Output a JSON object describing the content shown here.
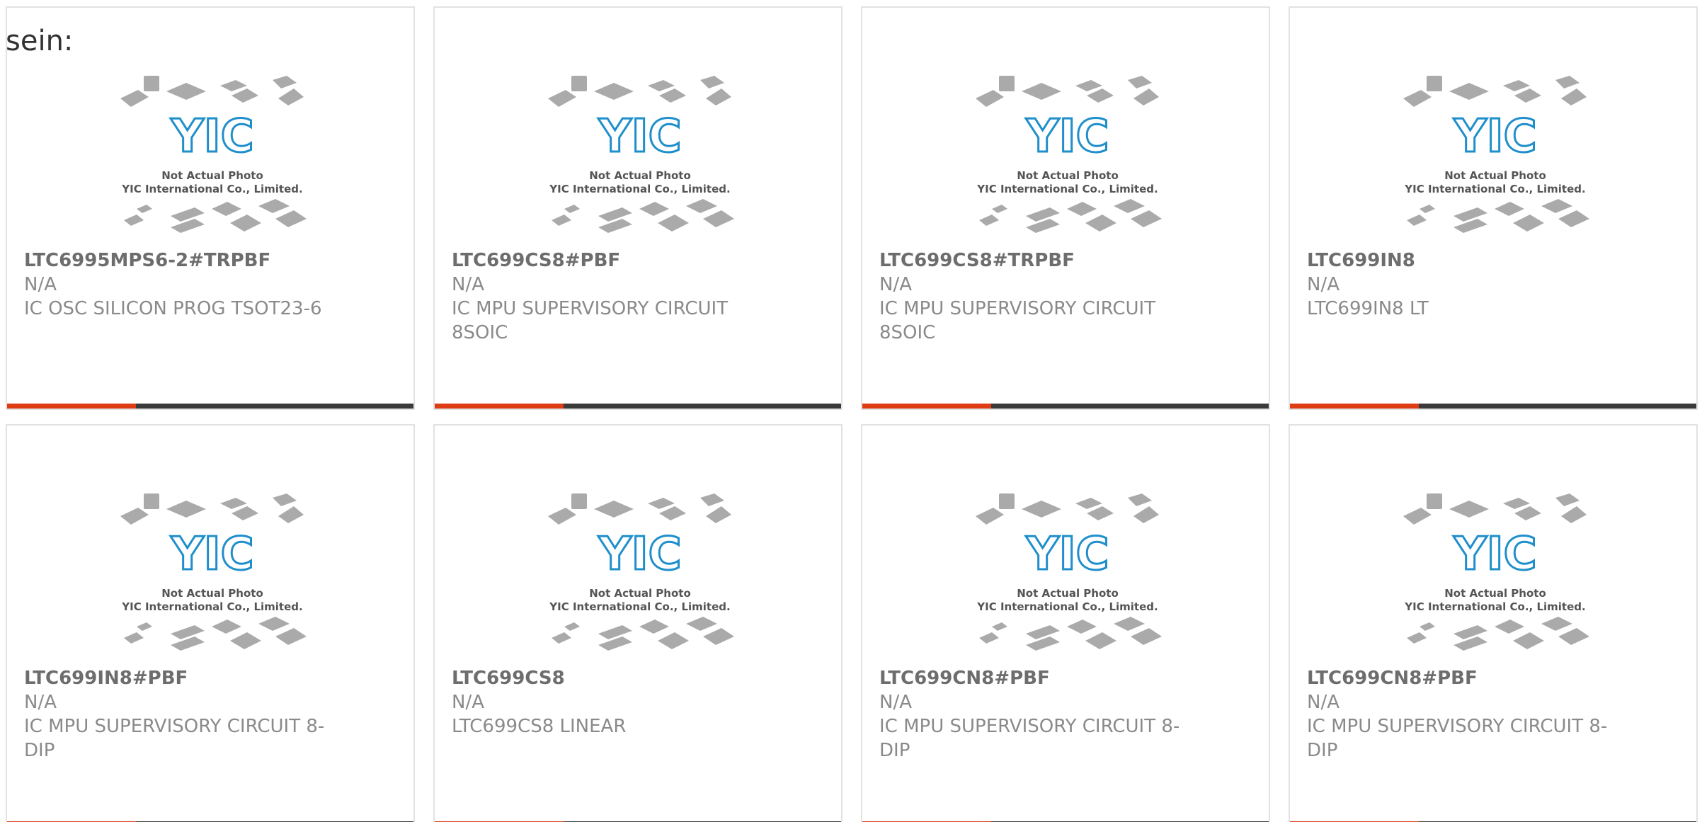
{
  "page": {
    "label_prefix": "sein:"
  },
  "placeholder": {
    "caption_line1": "Not Actual Photo",
    "caption_line2": "YIC International Co., Limited."
  },
  "colors": {
    "accent": "#dd3c15",
    "bar": "#3a3a3a",
    "logo_blue": "#1f8fcb"
  },
  "products": [
    {
      "part": "LTC6995MPS6-2#TRPBF",
      "mfr": "N/A",
      "desc": "IC OSC SILICON PROG TSOT23-6"
    },
    {
      "part": "LTC699CS8#PBF",
      "mfr": "N/A",
      "desc": "IC MPU SUPERVISORY CIRCUIT 8SOIC"
    },
    {
      "part": "LTC699CS8#TRPBF",
      "mfr": "N/A",
      "desc": "IC MPU SUPERVISORY CIRCUIT 8SOIC"
    },
    {
      "part": "LTC699IN8",
      "mfr": "N/A",
      "desc": "LTC699IN8 LT"
    },
    {
      "part": "LTC699IN8#PBF",
      "mfr": "N/A",
      "desc": "IC MPU SUPERVISORY CIRCUIT 8-DIP"
    },
    {
      "part": "LTC699CS8",
      "mfr": "N/A",
      "desc": "LTC699CS8 LINEAR"
    },
    {
      "part": "LTC699CN8#PBF",
      "mfr": "N/A",
      "desc": "IC MPU SUPERVISORY CIRCUIT 8-DIP"
    },
    {
      "part": "LTC699CN8#PBF",
      "mfr": "N/A",
      "desc": "IC MPU SUPERVISORY CIRCUIT 8-DIP"
    }
  ]
}
